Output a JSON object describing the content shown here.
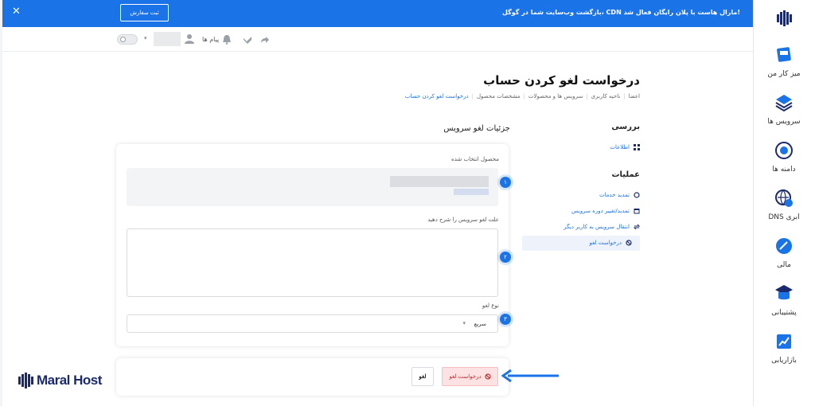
{
  "banner": {
    "text": "بازگشت وب‌سایت شما در گوگل، CDN مارال هاست با پلان رایگان فعال شد!",
    "button": "ثبت سفارش"
  },
  "topbar": {
    "messages": "پیام ها"
  },
  "sidebar": {
    "items": [
      {
        "label": "میز کار من",
        "icon": "desk-icon"
      },
      {
        "label": "سرویس ها",
        "icon": "services-icon"
      },
      {
        "label": "دامنه ها",
        "icon": "domains-icon"
      },
      {
        "label": "DNS ابری",
        "icon": "cloud-dns-icon"
      },
      {
        "label": "مالی",
        "icon": "finance-icon"
      },
      {
        "label": "پشتیبانی",
        "icon": "support-icon"
      },
      {
        "label": "بازاریابی",
        "icon": "marketing-icon"
      }
    ]
  },
  "page": {
    "title": "درخواست لغو کردن حساب",
    "breadcrumb": [
      "اعضا",
      "ناحیه کاربری",
      "سرویس ها و محصولات",
      "مشخصات محصول",
      "درخواست لغو کردن حساب"
    ]
  },
  "menu": {
    "overview_head": "بررسی",
    "info": "اطلاعات",
    "operations_head": "عملیات",
    "renew": "تمدید خدمات",
    "change_period": "تمدید/تغییر دوره سرویس",
    "transfer": "انتقال سرویس به کاربر دیگر",
    "cancel_request": "درخواست لغو"
  },
  "form": {
    "section_title": "جزئیات لغو سرویس",
    "product_label": "محصول انتخاب شده",
    "reason_label": "علت لغو سرویس را شرح دهید",
    "reason_value": "",
    "type_label": "نوع لغو",
    "type_value": "سریع",
    "steps": [
      "۱",
      "۲",
      "۳"
    ]
  },
  "actions": {
    "request_cancel": "درخواست لغو",
    "cancel": "لغو"
  },
  "brand": {
    "name": "Maral Host"
  },
  "colors": {
    "primary": "#1b73e8",
    "danger": "#c62828",
    "danger_bg": "#fde2e4"
  }
}
